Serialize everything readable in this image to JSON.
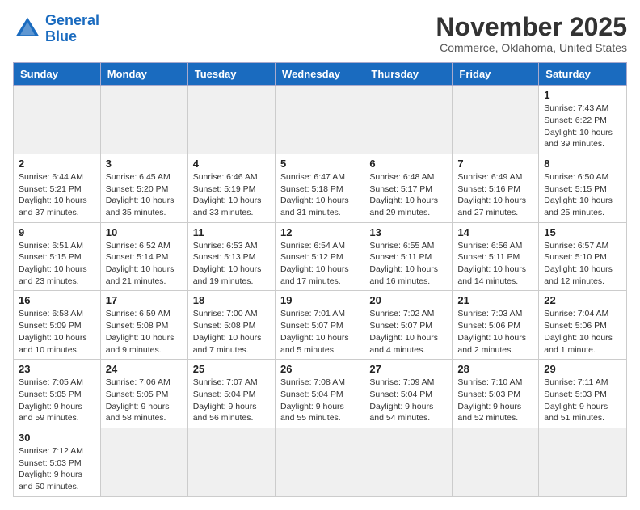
{
  "header": {
    "logo_general": "General",
    "logo_blue": "Blue",
    "month_title": "November 2025",
    "location": "Commerce, Oklahoma, United States"
  },
  "days_of_week": [
    "Sunday",
    "Monday",
    "Tuesday",
    "Wednesday",
    "Thursday",
    "Friday",
    "Saturday"
  ],
  "weeks": [
    [
      {
        "day": "",
        "empty": true
      },
      {
        "day": "",
        "empty": true
      },
      {
        "day": "",
        "empty": true
      },
      {
        "day": "",
        "empty": true
      },
      {
        "day": "",
        "empty": true
      },
      {
        "day": "",
        "empty": true
      },
      {
        "day": "1",
        "empty": false,
        "info": "Sunrise: 7:43 AM\nSunset: 6:22 PM\nDaylight: 10 hours\nand 39 minutes."
      }
    ],
    [
      {
        "day": "2",
        "empty": false,
        "info": "Sunrise: 6:44 AM\nSunset: 5:21 PM\nDaylight: 10 hours\nand 37 minutes."
      },
      {
        "day": "3",
        "empty": false,
        "info": "Sunrise: 6:45 AM\nSunset: 5:20 PM\nDaylight: 10 hours\nand 35 minutes."
      },
      {
        "day": "4",
        "empty": false,
        "info": "Sunrise: 6:46 AM\nSunset: 5:19 PM\nDaylight: 10 hours\nand 33 minutes."
      },
      {
        "day": "5",
        "empty": false,
        "info": "Sunrise: 6:47 AM\nSunset: 5:18 PM\nDaylight: 10 hours\nand 31 minutes."
      },
      {
        "day": "6",
        "empty": false,
        "info": "Sunrise: 6:48 AM\nSunset: 5:17 PM\nDaylight: 10 hours\nand 29 minutes."
      },
      {
        "day": "7",
        "empty": false,
        "info": "Sunrise: 6:49 AM\nSunset: 5:16 PM\nDaylight: 10 hours\nand 27 minutes."
      },
      {
        "day": "8",
        "empty": false,
        "info": "Sunrise: 6:50 AM\nSunset: 5:15 PM\nDaylight: 10 hours\nand 25 minutes."
      }
    ],
    [
      {
        "day": "9",
        "empty": false,
        "info": "Sunrise: 6:51 AM\nSunset: 5:15 PM\nDaylight: 10 hours\nand 23 minutes."
      },
      {
        "day": "10",
        "empty": false,
        "info": "Sunrise: 6:52 AM\nSunset: 5:14 PM\nDaylight: 10 hours\nand 21 minutes."
      },
      {
        "day": "11",
        "empty": false,
        "info": "Sunrise: 6:53 AM\nSunset: 5:13 PM\nDaylight: 10 hours\nand 19 minutes."
      },
      {
        "day": "12",
        "empty": false,
        "info": "Sunrise: 6:54 AM\nSunset: 5:12 PM\nDaylight: 10 hours\nand 17 minutes."
      },
      {
        "day": "13",
        "empty": false,
        "info": "Sunrise: 6:55 AM\nSunset: 5:11 PM\nDaylight: 10 hours\nand 16 minutes."
      },
      {
        "day": "14",
        "empty": false,
        "info": "Sunrise: 6:56 AM\nSunset: 5:11 PM\nDaylight: 10 hours\nand 14 minutes."
      },
      {
        "day": "15",
        "empty": false,
        "info": "Sunrise: 6:57 AM\nSunset: 5:10 PM\nDaylight: 10 hours\nand 12 minutes."
      }
    ],
    [
      {
        "day": "16",
        "empty": false,
        "info": "Sunrise: 6:58 AM\nSunset: 5:09 PM\nDaylight: 10 hours\nand 10 minutes."
      },
      {
        "day": "17",
        "empty": false,
        "info": "Sunrise: 6:59 AM\nSunset: 5:08 PM\nDaylight: 10 hours\nand 9 minutes."
      },
      {
        "day": "18",
        "empty": false,
        "info": "Sunrise: 7:00 AM\nSunset: 5:08 PM\nDaylight: 10 hours\nand 7 minutes."
      },
      {
        "day": "19",
        "empty": false,
        "info": "Sunrise: 7:01 AM\nSunset: 5:07 PM\nDaylight: 10 hours\nand 5 minutes."
      },
      {
        "day": "20",
        "empty": false,
        "info": "Sunrise: 7:02 AM\nSunset: 5:07 PM\nDaylight: 10 hours\nand 4 minutes."
      },
      {
        "day": "21",
        "empty": false,
        "info": "Sunrise: 7:03 AM\nSunset: 5:06 PM\nDaylight: 10 hours\nand 2 minutes."
      },
      {
        "day": "22",
        "empty": false,
        "info": "Sunrise: 7:04 AM\nSunset: 5:06 PM\nDaylight: 10 hours\nand 1 minute."
      }
    ],
    [
      {
        "day": "23",
        "empty": false,
        "info": "Sunrise: 7:05 AM\nSunset: 5:05 PM\nDaylight: 9 hours\nand 59 minutes."
      },
      {
        "day": "24",
        "empty": false,
        "info": "Sunrise: 7:06 AM\nSunset: 5:05 PM\nDaylight: 9 hours\nand 58 minutes."
      },
      {
        "day": "25",
        "empty": false,
        "info": "Sunrise: 7:07 AM\nSunset: 5:04 PM\nDaylight: 9 hours\nand 56 minutes."
      },
      {
        "day": "26",
        "empty": false,
        "info": "Sunrise: 7:08 AM\nSunset: 5:04 PM\nDaylight: 9 hours\nand 55 minutes."
      },
      {
        "day": "27",
        "empty": false,
        "info": "Sunrise: 7:09 AM\nSunset: 5:04 PM\nDaylight: 9 hours\nand 54 minutes."
      },
      {
        "day": "28",
        "empty": false,
        "info": "Sunrise: 7:10 AM\nSunset: 5:03 PM\nDaylight: 9 hours\nand 52 minutes."
      },
      {
        "day": "29",
        "empty": false,
        "info": "Sunrise: 7:11 AM\nSunset: 5:03 PM\nDaylight: 9 hours\nand 51 minutes."
      }
    ],
    [
      {
        "day": "30",
        "empty": false,
        "info": "Sunrise: 7:12 AM\nSunset: 5:03 PM\nDaylight: 9 hours\nand 50 minutes."
      },
      {
        "day": "",
        "empty": true
      },
      {
        "day": "",
        "empty": true
      },
      {
        "day": "",
        "empty": true
      },
      {
        "day": "",
        "empty": true
      },
      {
        "day": "",
        "empty": true
      },
      {
        "day": "",
        "empty": true
      }
    ]
  ]
}
